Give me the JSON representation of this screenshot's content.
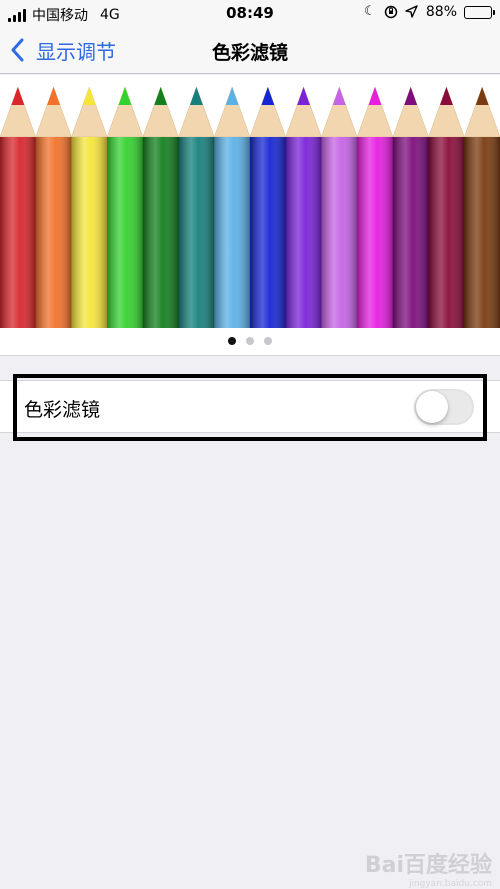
{
  "status_bar": {
    "carrier": "中国移动",
    "network": "4G",
    "time": "08:49",
    "battery_percent": "88%",
    "battery_level": 0.88,
    "icons": [
      "do-not-disturb-moon-icon",
      "orientation-lock-icon",
      "location-arrow-icon"
    ]
  },
  "nav": {
    "back_label": "显示调节",
    "title": "色彩滤镜"
  },
  "preview": {
    "pencil_colors": [
      "#d8262c",
      "#f2722a",
      "#f5e53a",
      "#34d22e",
      "#13801f",
      "#16807c",
      "#5bb1e6",
      "#1726d4",
      "#7a22d8",
      "#c763e6",
      "#e61ee0",
      "#7d0d7d",
      "#8a0c3a",
      "#7a3b10"
    ],
    "page_count": 3,
    "current_page": 0
  },
  "settings": {
    "color_filter_label": "色彩滤镜",
    "color_filter_enabled": false
  },
  "watermark": {
    "text": "Bai百度经验",
    "sub": "jingyan.baidu.com"
  }
}
